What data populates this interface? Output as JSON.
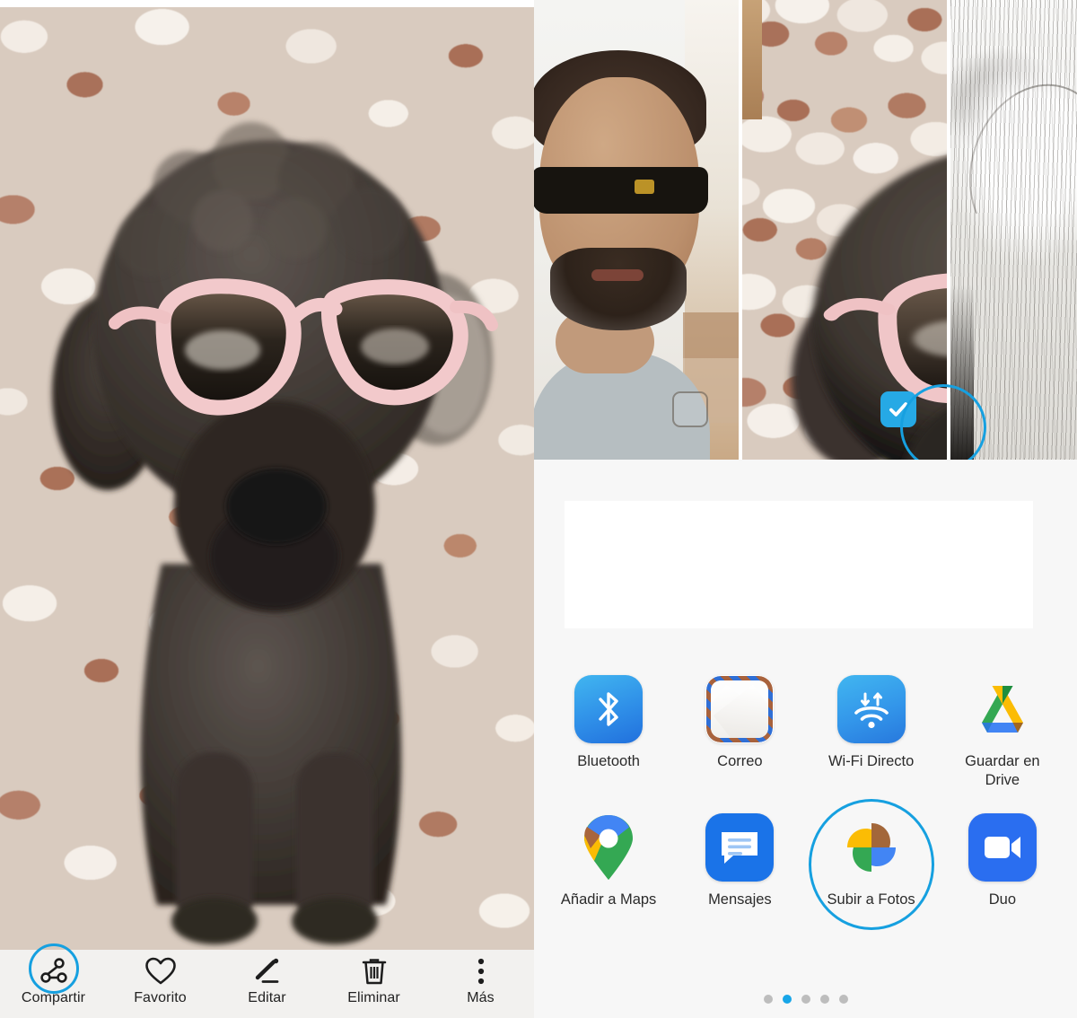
{
  "app": {
    "screen_name": "Galería - visor de foto con hoja de compartir",
    "language": "es",
    "accent_color": "#16a0e0",
    "highlight_color": "#16a0e0",
    "sheet_background": "#f7f7f7",
    "toolbar_background": "#f2f1ef"
  },
  "viewer": {
    "photo_alt": "Caniche gris con gafas de sol rosas sobre suelo de terrazo",
    "toolbar": {
      "items": [
        {
          "label": "Compartir",
          "icon": "share-icon",
          "highlighted": true
        },
        {
          "label": "Favorito",
          "icon": "heart-icon",
          "highlighted": false
        },
        {
          "label": "Editar",
          "icon": "pencil-icon",
          "highlighted": false
        },
        {
          "label": "Eliminar",
          "icon": "trash-icon",
          "highlighted": false
        },
        {
          "label": "Más",
          "icon": "more-vertical-icon",
          "highlighted": false
        }
      ]
    }
  },
  "share_sheet": {
    "thumbnails": [
      {
        "alt": "Selfie de hombre con gafas de sol y barba",
        "selected": false,
        "checkbox_icon": "checkbox-unchecked-icon"
      },
      {
        "alt": "Caniche gris con gafas de sol rosas",
        "selected": true,
        "checkbox_icon": "checkbox-checked-icon",
        "highlighted": true
      },
      {
        "alt": "Foto clara con trazos de lápiz",
        "selected": false,
        "checkbox_icon": "none"
      }
    ],
    "preview_card": {
      "content": ""
    },
    "apps": [
      {
        "label": "Bluetooth",
        "icon": "bluetooth-icon",
        "highlighted": false
      },
      {
        "label": "Correo",
        "icon": "mail-icon",
        "highlighted": false
      },
      {
        "label": "Wi-Fi Directo",
        "icon": "wifi-direct-icon",
        "highlighted": false
      },
      {
        "label": "Guardar en Drive",
        "icon": "google-drive-icon",
        "highlighted": false
      },
      {
        "label": "Añadir a Maps",
        "icon": "google-maps-icon",
        "highlighted": false
      },
      {
        "label": "Mensajes",
        "icon": "messages-icon",
        "highlighted": false
      },
      {
        "label": "Subir a Fotos",
        "icon": "google-photos-icon",
        "highlighted": true
      },
      {
        "label": "Duo",
        "icon": "google-duo-icon",
        "highlighted": false
      }
    ],
    "pagination": {
      "total": 5,
      "active_index": 1
    }
  }
}
